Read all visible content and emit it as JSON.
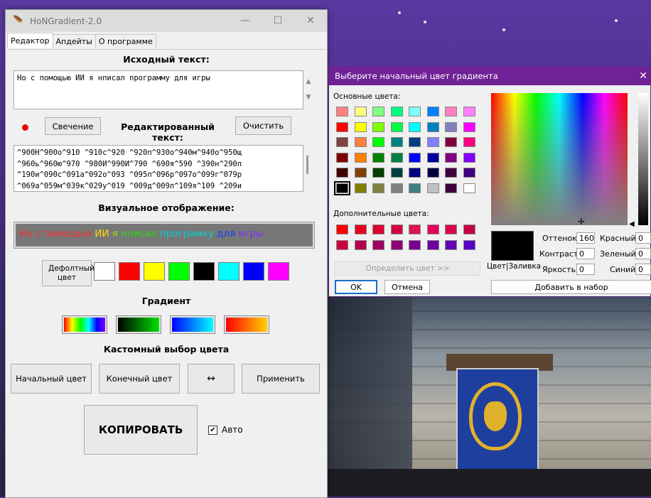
{
  "main_window": {
    "title": "HoNGradient-2.0",
    "tabs": [
      "Редактор",
      "Апдейты",
      "О программе"
    ],
    "source_label": "Исходный текст:",
    "source_text": "Но с помощью ИИ я нписал программу для игры",
    "glow_button": "Свечение",
    "edited_label": "Редактированный текст:",
    "clear_button": "Очистить",
    "edited_lines": [
      "^900Н^900о^910 ^910с^920 ^920п^930о^940м^940о^950щ",
      "^960ь^960ю^970 ^980И^990И^790 ^690я^590 ^390н^290п",
      "^190и^090с^091а^092о^093 ^095п^096р^097о^099г^079р",
      "^069а^059м^039к^029у^019 ^009д^009л^109я^109 ^209и"
    ],
    "visual_label": "Визуальное отображение:",
    "preview_segments": [
      {
        "text": "Но с помощью ",
        "color": "#ff2a2a"
      },
      {
        "text": "ИИ ",
        "color": "#ffd800"
      },
      {
        "text": "я ",
        "color": "#9be000"
      },
      {
        "text": "нписао ",
        "color": "#22e000"
      },
      {
        "text": "програмку ",
        "color": "#00d0d0"
      },
      {
        "text": "для ",
        "color": "#1a3cff"
      },
      {
        "text": "игры",
        "color": "#7a2cff"
      }
    ],
    "default_color_button": "Дефолтный цвет",
    "swatches": [
      "#ffffff",
      "#ff0000",
      "#ffff00",
      "#00ff00",
      "#000000",
      "#00ffff",
      "#0000ff",
      "#ff00ff"
    ],
    "gradient_label": "Градиент",
    "custom_label": "Кастомный выбор цвета",
    "start_color_button": "Начальный цвет",
    "end_color_button": "Конечный цвет",
    "swap_button": "↔",
    "apply_button": "Применить",
    "copy_button": "КОПИРОВАТЬ",
    "auto_label": "Авто",
    "auto_checked": true
  },
  "color_dialog": {
    "title": "Выберите начальный цвет градиента",
    "basic_label": "Основные цвета:",
    "basic_colors": [
      "#ff8080",
      "#ffff80",
      "#80ff80",
      "#00ff80",
      "#80ffff",
      "#0080ff",
      "#ff80c0",
      "#ff80ff",
      "#ff0000",
      "#ffff00",
      "#80ff00",
      "#00ff40",
      "#00ffff",
      "#0080c0",
      "#8080c0",
      "#ff00ff",
      "#804040",
      "#ff8040",
      "#00ff00",
      "#008080",
      "#004080",
      "#8080ff",
      "#800040",
      "#ff0080",
      "#800000",
      "#ff8000",
      "#008000",
      "#008040",
      "#0000ff",
      "#0000a0",
      "#800080",
      "#8000ff",
      "#400000",
      "#804000",
      "#004000",
      "#004040",
      "#000080",
      "#000040",
      "#400040",
      "#400080",
      "#000000",
      "#808000",
      "#808040",
      "#808080",
      "#408080",
      "#c0c0c0",
      "#400040",
      "#ffffff"
    ],
    "custom_label": "Дополнительные цвета:",
    "custom_colors": [
      "#ff0000",
      "#e60020",
      "#dc0030",
      "#d20040",
      "#dc1450",
      "#e6005a",
      "#dc0050",
      "#c80040",
      "#c8003c",
      "#b40050",
      "#a00064",
      "#8c0078",
      "#78008c",
      "#6e00a0",
      "#6400b4",
      "#5a00c8"
    ],
    "define_button": "Определить цвет >>",
    "ok_button": "OK",
    "cancel_button": "Отмена",
    "color_solid_label": "Цвет|Заливка",
    "hue_label": "Оттенок:",
    "hue_value": "160",
    "sat_label": "Контраст:",
    "sat_value": "0",
    "lum_label": "Яркость:",
    "lum_value": "0",
    "red_label": "Красный:",
    "red_value": "0",
    "green_label": "Зеленый:",
    "green_value": "0",
    "blue_label": "Синий:",
    "blue_value": "0",
    "add_button": "Добавить в набор"
  }
}
